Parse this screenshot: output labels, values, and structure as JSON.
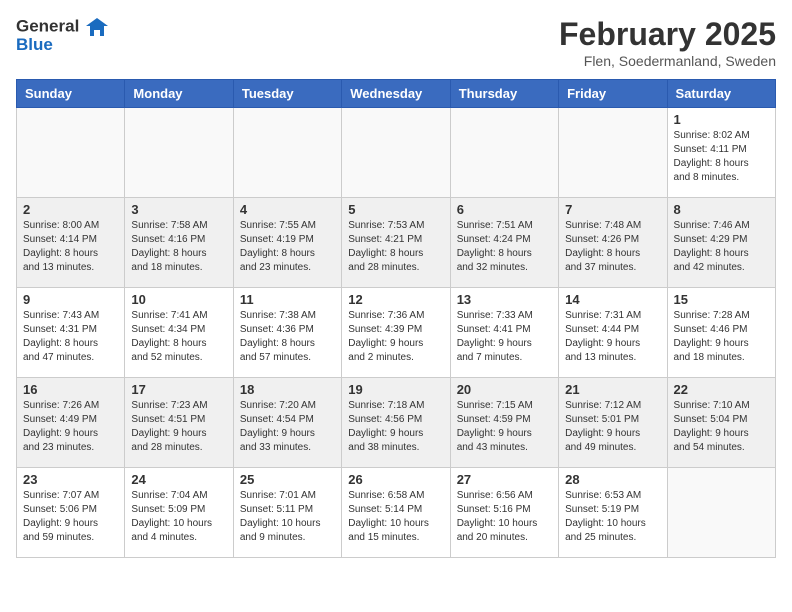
{
  "header": {
    "logo_general": "General",
    "logo_blue": "Blue",
    "month": "February 2025",
    "location": "Flen, Soedermanland, Sweden"
  },
  "weekdays": [
    "Sunday",
    "Monday",
    "Tuesday",
    "Wednesday",
    "Thursday",
    "Friday",
    "Saturday"
  ],
  "weeks": [
    [
      {
        "day": "",
        "info": ""
      },
      {
        "day": "",
        "info": ""
      },
      {
        "day": "",
        "info": ""
      },
      {
        "day": "",
        "info": ""
      },
      {
        "day": "",
        "info": ""
      },
      {
        "day": "",
        "info": ""
      },
      {
        "day": "1",
        "info": "Sunrise: 8:02 AM\nSunset: 4:11 PM\nDaylight: 8 hours\nand 8 minutes."
      }
    ],
    [
      {
        "day": "2",
        "info": "Sunrise: 8:00 AM\nSunset: 4:14 PM\nDaylight: 8 hours\nand 13 minutes."
      },
      {
        "day": "3",
        "info": "Sunrise: 7:58 AM\nSunset: 4:16 PM\nDaylight: 8 hours\nand 18 minutes."
      },
      {
        "day": "4",
        "info": "Sunrise: 7:55 AM\nSunset: 4:19 PM\nDaylight: 8 hours\nand 23 minutes."
      },
      {
        "day": "5",
        "info": "Sunrise: 7:53 AM\nSunset: 4:21 PM\nDaylight: 8 hours\nand 28 minutes."
      },
      {
        "day": "6",
        "info": "Sunrise: 7:51 AM\nSunset: 4:24 PM\nDaylight: 8 hours\nand 32 minutes."
      },
      {
        "day": "7",
        "info": "Sunrise: 7:48 AM\nSunset: 4:26 PM\nDaylight: 8 hours\nand 37 minutes."
      },
      {
        "day": "8",
        "info": "Sunrise: 7:46 AM\nSunset: 4:29 PM\nDaylight: 8 hours\nand 42 minutes."
      }
    ],
    [
      {
        "day": "9",
        "info": "Sunrise: 7:43 AM\nSunset: 4:31 PM\nDaylight: 8 hours\nand 47 minutes."
      },
      {
        "day": "10",
        "info": "Sunrise: 7:41 AM\nSunset: 4:34 PM\nDaylight: 8 hours\nand 52 minutes."
      },
      {
        "day": "11",
        "info": "Sunrise: 7:38 AM\nSunset: 4:36 PM\nDaylight: 8 hours\nand 57 minutes."
      },
      {
        "day": "12",
        "info": "Sunrise: 7:36 AM\nSunset: 4:39 PM\nDaylight: 9 hours\nand 2 minutes."
      },
      {
        "day": "13",
        "info": "Sunrise: 7:33 AM\nSunset: 4:41 PM\nDaylight: 9 hours\nand 7 minutes."
      },
      {
        "day": "14",
        "info": "Sunrise: 7:31 AM\nSunset: 4:44 PM\nDaylight: 9 hours\nand 13 minutes."
      },
      {
        "day": "15",
        "info": "Sunrise: 7:28 AM\nSunset: 4:46 PM\nDaylight: 9 hours\nand 18 minutes."
      }
    ],
    [
      {
        "day": "16",
        "info": "Sunrise: 7:26 AM\nSunset: 4:49 PM\nDaylight: 9 hours\nand 23 minutes."
      },
      {
        "day": "17",
        "info": "Sunrise: 7:23 AM\nSunset: 4:51 PM\nDaylight: 9 hours\nand 28 minutes."
      },
      {
        "day": "18",
        "info": "Sunrise: 7:20 AM\nSunset: 4:54 PM\nDaylight: 9 hours\nand 33 minutes."
      },
      {
        "day": "19",
        "info": "Sunrise: 7:18 AM\nSunset: 4:56 PM\nDaylight: 9 hours\nand 38 minutes."
      },
      {
        "day": "20",
        "info": "Sunrise: 7:15 AM\nSunset: 4:59 PM\nDaylight: 9 hours\nand 43 minutes."
      },
      {
        "day": "21",
        "info": "Sunrise: 7:12 AM\nSunset: 5:01 PM\nDaylight: 9 hours\nand 49 minutes."
      },
      {
        "day": "22",
        "info": "Sunrise: 7:10 AM\nSunset: 5:04 PM\nDaylight: 9 hours\nand 54 minutes."
      }
    ],
    [
      {
        "day": "23",
        "info": "Sunrise: 7:07 AM\nSunset: 5:06 PM\nDaylight: 9 hours\nand 59 minutes."
      },
      {
        "day": "24",
        "info": "Sunrise: 7:04 AM\nSunset: 5:09 PM\nDaylight: 10 hours\nand 4 minutes."
      },
      {
        "day": "25",
        "info": "Sunrise: 7:01 AM\nSunset: 5:11 PM\nDaylight: 10 hours\nand 9 minutes."
      },
      {
        "day": "26",
        "info": "Sunrise: 6:58 AM\nSunset: 5:14 PM\nDaylight: 10 hours\nand 15 minutes."
      },
      {
        "day": "27",
        "info": "Sunrise: 6:56 AM\nSunset: 5:16 PM\nDaylight: 10 hours\nand 20 minutes."
      },
      {
        "day": "28",
        "info": "Sunrise: 6:53 AM\nSunset: 5:19 PM\nDaylight: 10 hours\nand 25 minutes."
      },
      {
        "day": "",
        "info": ""
      }
    ]
  ]
}
